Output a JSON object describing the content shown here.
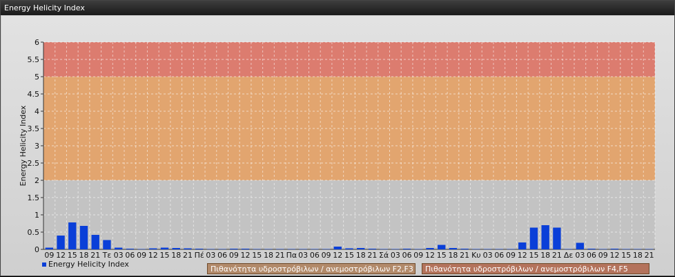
{
  "window": {
    "title": "Energy Helicity Index"
  },
  "chart_data": {
    "type": "bar",
    "title": "",
    "xlabel": "",
    "ylabel": "Energy Helicity Index",
    "ylim": [
      0,
      6
    ],
    "yticks": [
      "0",
      "0.5",
      "1",
      "1.5",
      "2",
      "2.5",
      "3",
      "3.5",
      "4",
      "4.5",
      "5",
      "5.5",
      "6"
    ],
    "grid": true,
    "legend_placement": "bottom-left",
    "bands": [
      {
        "from": 2,
        "to": 5,
        "color": "#e8a060",
        "label": "Πιθανότητα υδροστρόβιλων / ανεμοστρόβιλων F2,F3"
      },
      {
        "from": 5,
        "to": 6,
        "color": "#e07060",
        "label": "Πιθανότητα υδροστρόβιλων / ανεμοστρόβιλων F4,F5"
      }
    ],
    "categories": [
      "09",
      "12",
      "15",
      "18",
      "21",
      "Τε",
      "03",
      "06",
      "09",
      "12",
      "15",
      "18",
      "21",
      "Πέ",
      "03",
      "06",
      "09",
      "12",
      "15",
      "18",
      "21",
      "Πα",
      "03",
      "06",
      "09",
      "12",
      "15",
      "18",
      "21",
      "Σά",
      "03",
      "06",
      "09",
      "12",
      "15",
      "18",
      "21",
      "Κυ",
      "03",
      "06",
      "09",
      "12",
      "15",
      "18",
      "21",
      "Δε",
      "03",
      "06",
      "09",
      "12",
      "15",
      "18",
      "21"
    ],
    "series": [
      {
        "name": "Energy Helicity Index",
        "color": "#0a3fd8",
        "values": [
          0.05,
          0.4,
          0.78,
          0.68,
          0.42,
          0.27,
          0.05,
          0.02,
          0.01,
          0.03,
          0.05,
          0.04,
          0.03,
          0.02,
          0.01,
          0.01,
          0.02,
          0.02,
          0.01,
          0.01,
          0.01,
          0.01,
          0.01,
          0.01,
          0.01,
          0.08,
          0.03,
          0.04,
          0.02,
          0.01,
          0.01,
          0.02,
          0.01,
          0.04,
          0.13,
          0.04,
          0.02,
          0.01,
          0.01,
          0.01,
          0.01,
          0.2,
          0.63,
          0.7,
          0.63,
          0.01,
          0.19,
          0.02,
          0.01,
          0.02,
          0.01,
          0.01,
          0.01
        ]
      }
    ]
  }
}
